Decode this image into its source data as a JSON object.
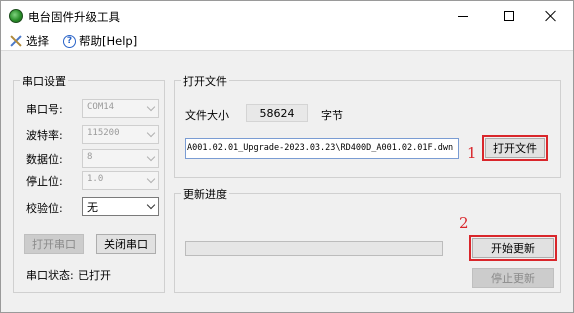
{
  "window": {
    "title": "电台固件升级工具"
  },
  "menu": {
    "select_label": "选择",
    "help_label": "帮助[Help]"
  },
  "serial": {
    "group_title": "串口设置",
    "port_label": "串口号:",
    "port_value": "COM14",
    "baud_label": "波特率:",
    "baud_value": "115200",
    "data_label": "数据位:",
    "data_value": "8",
    "stop_label": "停止位:",
    "stop_value": "1.0",
    "parity_label": "校验位:",
    "parity_value": "无",
    "open_label": "打开串口",
    "close_label": "关闭串口",
    "status_label": "串口状态:",
    "status_value": "已打开"
  },
  "file": {
    "group_title": "打开文件",
    "size_label": "文件大小",
    "size_value": "58624",
    "size_unit": "字节",
    "path_value": "A001.02.01_Upgrade-2023.03.23\\RD400D_A001.02.01F.dwn",
    "open_label": "打开文件"
  },
  "progress": {
    "group_title": "更新进度",
    "value": 0,
    "start_label": "开始更新",
    "stop_label": "停止更新"
  },
  "annotations": {
    "step1": "1",
    "step2": "2"
  },
  "colors": {
    "highlight": "#d9262b",
    "progress_fill": "#06b025"
  }
}
